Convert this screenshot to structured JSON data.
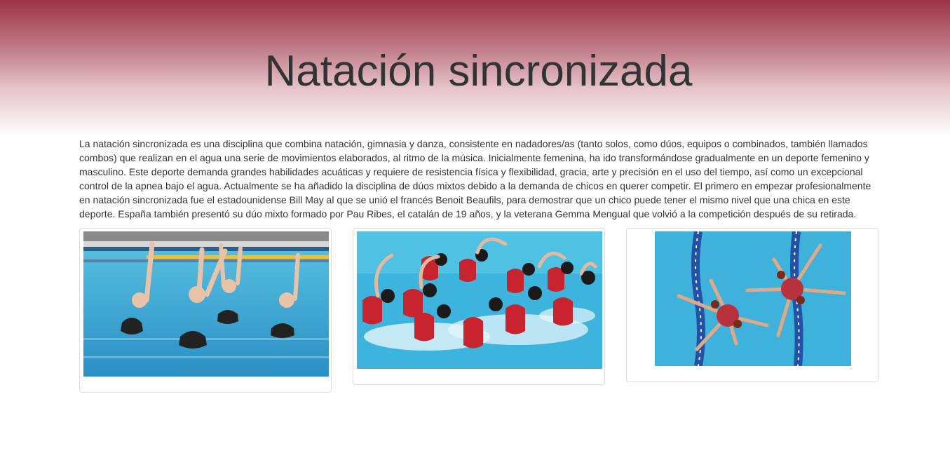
{
  "header": {
    "title": "Natación sincronizada"
  },
  "intro": {
    "text": "La natación sincronizada es una disciplina que combina natación, gimnasia y danza, consistente en nadadores/as (tanto solos, como dúos, equipos o combinados, también llamados combos) que realizan en el agua una serie de movimientos elaborados, al ritmo de la música. Inicialmente femenina, ha ido transformándose gradualmente en un deporte femenino y masculino. Este deporte demanda grandes habilidades acuáticas y requiere de resistencia física y flexibilidad, gracia, arte y precisión en el uso del tiempo, así como un excepcional control de la apnea bajo el agua. Actualmente se ha añadido la disciplina de dúos mixtos debido a la demanda de chicos en querer competir. El primero en empezar profesionalmente en natación sincronizada fue el estadounidense Bill May al que se unió el francés Benoit Beaufils, para demostrar que un chico puede tener el mismo nivel que una chica en este deporte. España también presentó su dúo mixto formado por Pau Ribes, el catalán de 19 años, y la veterana Gemma Mengual que volvió a la competición después de su retirada."
  },
  "gallery": {
    "images": [
      {
        "name": "swimmers-black-suits-photo"
      },
      {
        "name": "swimmers-red-suits-photo"
      },
      {
        "name": "swimmers-star-formation-photo"
      }
    ]
  },
  "colors": {
    "header_top": "#9b3447",
    "title_text": "#333333",
    "pool_water": "#3fb2dc",
    "card_border": "#dddddd"
  }
}
